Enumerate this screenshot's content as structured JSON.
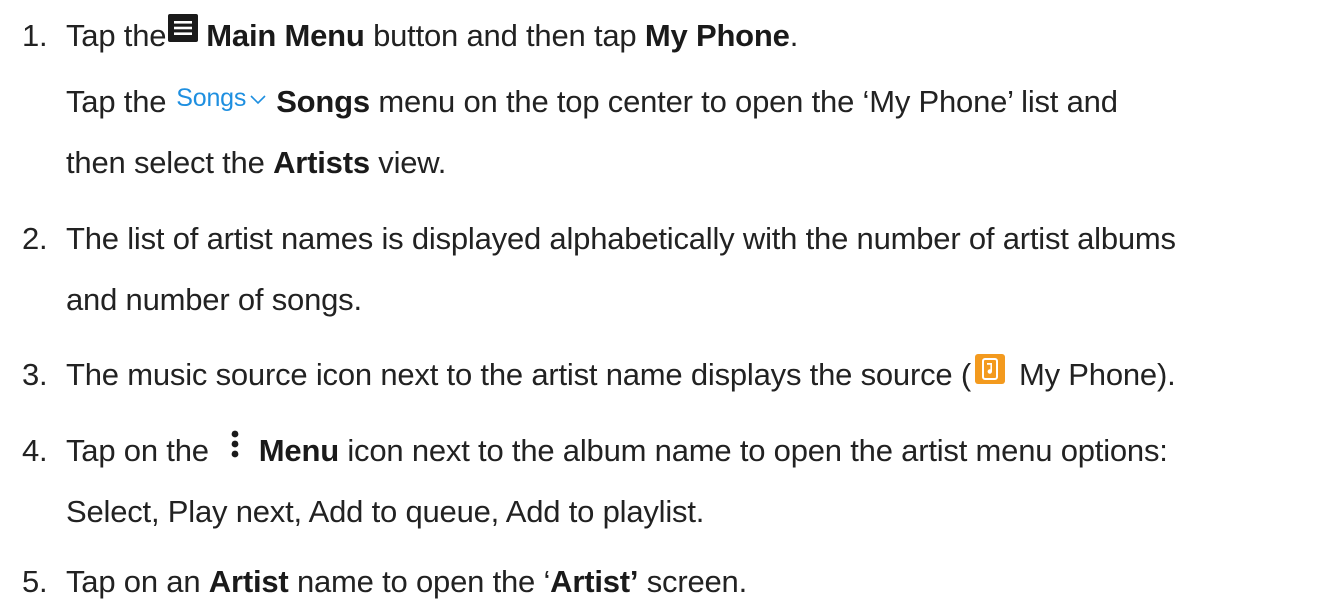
{
  "steps": [
    {
      "num": "1.",
      "l1": {
        "a": "Tap the",
        "b": "Main Menu",
        "c": " button and then tap ",
        "d": "My Phone",
        "e": "."
      },
      "l2": {
        "a": "Tap the",
        "chip": "Songs",
        "b": "Songs",
        "c": " menu on the top center to open the ‘My Phone’ list and"
      },
      "l3": {
        "a": "then select the ",
        "b": "Artists",
        "c": " view."
      }
    },
    {
      "num": "2.",
      "l1": "The list of artist names is displayed alphabetically with the number of artist albums",
      "l2": "and number of songs."
    },
    {
      "num": "3.",
      "l1": {
        "a": "The music source icon next to the artist name displays the source (",
        "b": "My Phone)."
      }
    },
    {
      "num": "4.",
      "l1": {
        "a": "Tap on the",
        "b": "Menu",
        "c": " icon next to the album name to open the artist menu options:"
      },
      "l2": "Select, Play next, Add to queue, Add to playlist."
    },
    {
      "num": "5.",
      "l1": {
        "a": "Tap on an ",
        "b": "Artist",
        "c": " name to open the ‘",
        "d": "Artist’",
        "e": " screen."
      }
    }
  ],
  "icons": {
    "main_menu": "hamburger-menu-icon",
    "songs_chevron": "chevron-down-icon",
    "phone_source": "phone-music-source-icon",
    "menu": "vertical-dots-menu-icon"
  },
  "colors": {
    "text": "#222222",
    "songs_chip": "#1e8fe0",
    "phone_source_bg": "#f39a1e"
  }
}
